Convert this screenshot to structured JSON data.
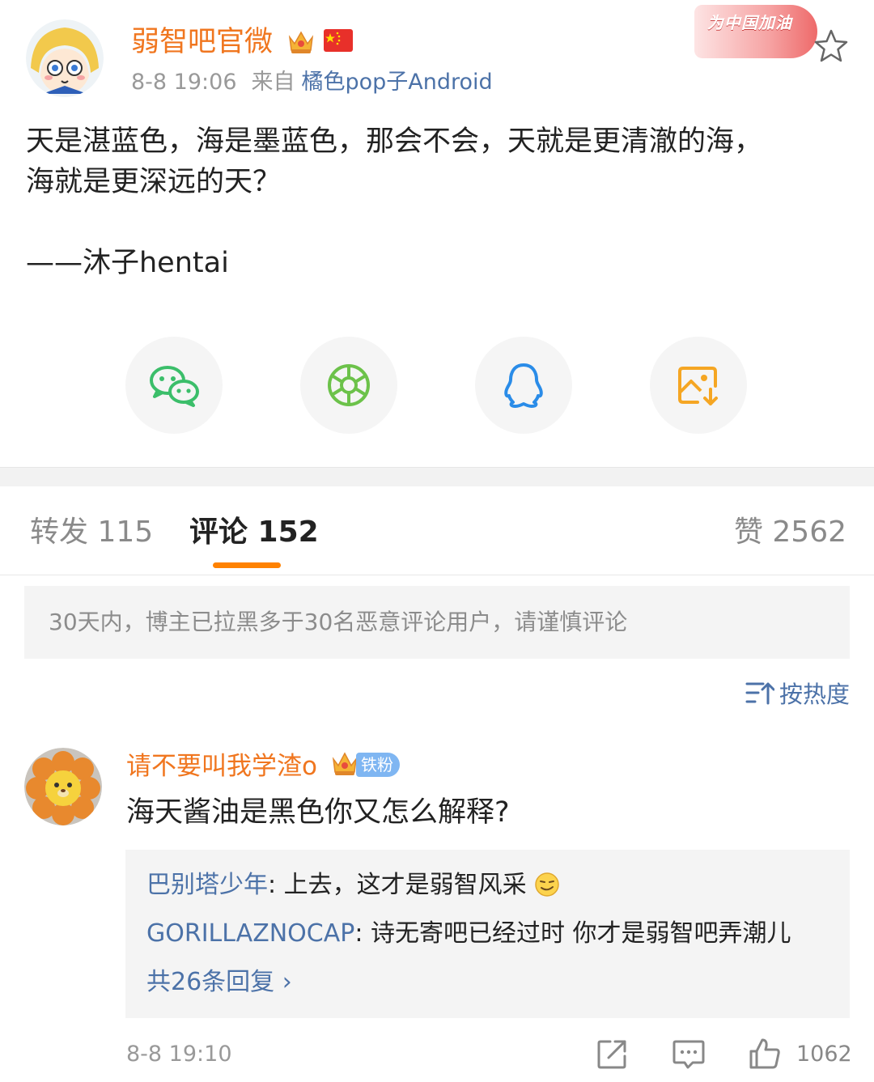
{
  "post": {
    "author": "弱智吧官微",
    "time": "8-8 19:06",
    "from_label": "来自",
    "source": "橘色pop子Android",
    "badge_text": "为中国加油",
    "text": "天是湛蓝色，海是墨蓝色，那会不会，天就是更清澈的海，\n海就是更深远的天？\n\n——沐子hentai"
  },
  "share": {
    "items": [
      "wechat-icon",
      "moments-icon",
      "qq-icon",
      "save-image-icon"
    ],
    "colors": {
      "wechat": "#3bbe6a",
      "moments": "#6cc24a",
      "qq": "#2a8ce8",
      "save": "#f5a623"
    }
  },
  "tabs": {
    "repost": "转发 115",
    "comments": "评论 152",
    "likes": "赞 2562"
  },
  "notice": "30天内，博主已拉黑多于30名恶意评论用户，请谨慎评论",
  "sort_label": "按热度",
  "comment": {
    "user": "请不要叫我学渣o",
    "fan_badge": "铁粉",
    "text": "海天酱油是黑色你又怎么解释?",
    "replies": [
      {
        "user": "巴别塔少年",
        "text": ": 上去，这才是弱智风采"
      },
      {
        "user": "GORILLAZNOCAP",
        "text": ": 诗无寄吧已经过时 你才是弱智吧弄潮儿"
      }
    ],
    "more_replies": "共26条回复 ›",
    "time": "8-8 19:10",
    "likes": "1062"
  },
  "colors": {
    "accent_orange": "#f0761f",
    "link_blue": "#4c72a8",
    "tab_underline": "#ff8200"
  }
}
